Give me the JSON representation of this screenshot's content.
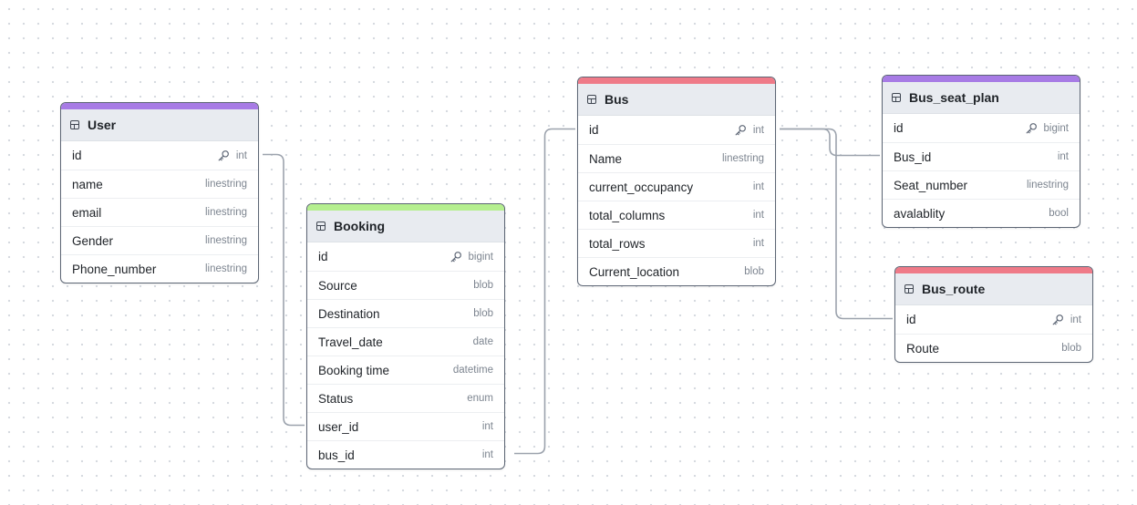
{
  "colors": {
    "purple": "#a77be5",
    "green": "#b5ef8f",
    "red": "#ef7a88",
    "border": "#5d6675",
    "header_bg": "#e8ebf0",
    "edge": "#9ca3ad"
  },
  "tables": [
    {
      "key": "user",
      "title": "User",
      "color": "#a77be5",
      "columns": [
        {
          "name": "id",
          "type": "int",
          "pk": true
        },
        {
          "name": "name",
          "type": "linestring"
        },
        {
          "name": "email",
          "type": "linestring"
        },
        {
          "name": "Gender",
          "type": "linestring"
        },
        {
          "name": "Phone_number",
          "type": "linestring"
        }
      ]
    },
    {
      "key": "booking",
      "title": "Booking",
      "color": "#b5ef8f",
      "columns": [
        {
          "name": "id",
          "type": "bigint",
          "pk": true
        },
        {
          "name": "Source",
          "type": "blob"
        },
        {
          "name": "Destination",
          "type": "blob"
        },
        {
          "name": "Travel_date",
          "type": "date"
        },
        {
          "name": "Booking time",
          "type": "datetime"
        },
        {
          "name": "Status",
          "type": "enum"
        },
        {
          "name": "user_id",
          "type": "int"
        },
        {
          "name": "bus_id",
          "type": "int"
        }
      ]
    },
    {
      "key": "bus",
      "title": "Bus",
      "color": "#ef7a88",
      "columns": [
        {
          "name": "id",
          "type": "int",
          "pk": true
        },
        {
          "name": "Name",
          "type": "linestring"
        },
        {
          "name": "current_occupancy",
          "type": "int"
        },
        {
          "name": "total_columns",
          "type": "int"
        },
        {
          "name": "total_rows",
          "type": "int"
        },
        {
          "name": "Current_location",
          "type": "blob"
        }
      ]
    },
    {
      "key": "bus_seat_plan",
      "title": "Bus_seat_plan",
      "color": "#a77be5",
      "columns": [
        {
          "name": "id",
          "type": "bigint",
          "pk": true
        },
        {
          "name": "Bus_id",
          "type": "int"
        },
        {
          "name": "Seat_number",
          "type": "linestring"
        },
        {
          "name": "avalablity",
          "type": "bool"
        }
      ]
    },
    {
      "key": "bus_route",
      "title": "Bus_route",
      "color": "#ef7a88",
      "columns": [
        {
          "name": "id",
          "type": "int",
          "pk": true
        },
        {
          "name": "Route",
          "type": "blob"
        }
      ]
    }
  ],
  "relations": [
    {
      "from": "user.id",
      "to": "booking.user_id"
    },
    {
      "from": "bus.id",
      "to": "booking.bus_id"
    },
    {
      "from": "bus.id",
      "to": "bus_seat_plan.Bus_id"
    },
    {
      "from": "bus.id",
      "to": "bus_route.id"
    }
  ]
}
